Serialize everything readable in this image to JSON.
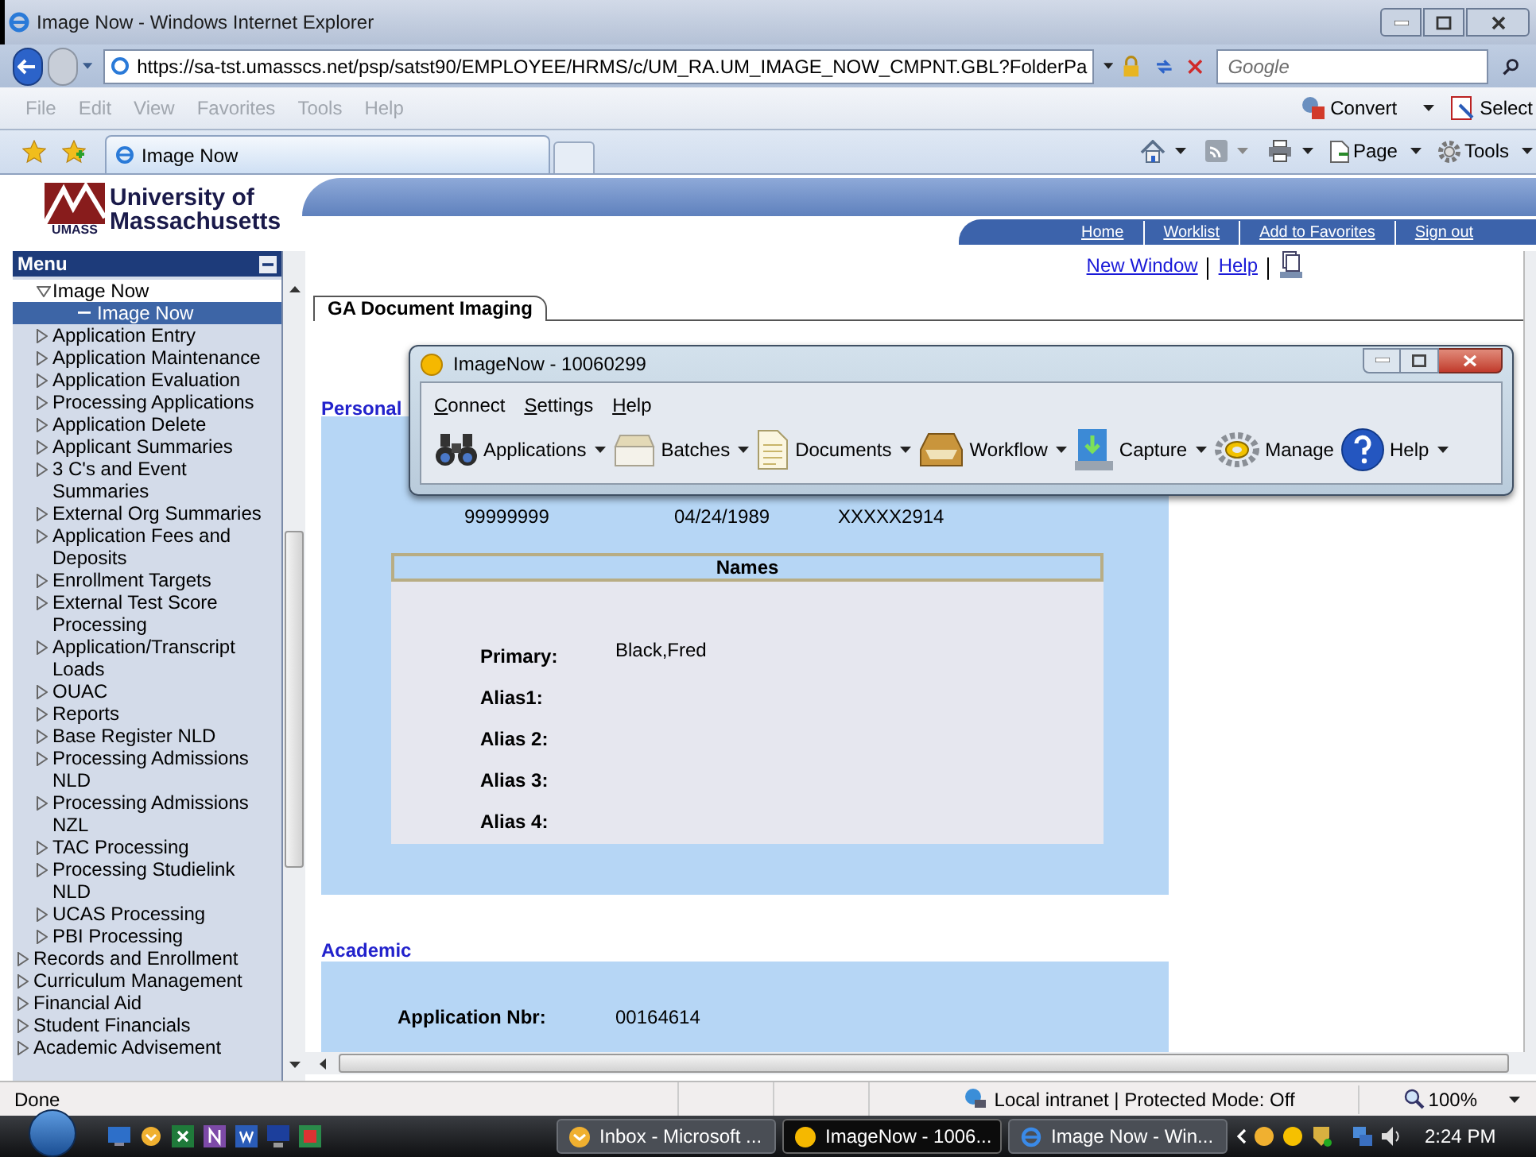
{
  "browser": {
    "title": "Image Now - Windows Internet Explorer",
    "address": "https://sa-tst.umasscs.net/psp/satst90/EMPLOYEE/HRMS/c/UM_RA.UM_IMAGE_NOW_CMPNT.GBL?FolderPa",
    "search_placeholder": "Google",
    "menu": [
      {
        "label": "File",
        "disabled": true
      },
      {
        "label": "Edit",
        "disabled": true
      },
      {
        "label": "View",
        "disabled": true
      },
      {
        "label": "Favorites",
        "disabled": true
      },
      {
        "label": "Tools",
        "disabled": true
      },
      {
        "label": "Help",
        "disabled": true
      }
    ],
    "commands": [
      {
        "label": "Convert",
        "dropdown": true
      },
      {
        "label": "Select",
        "dropdown": false
      }
    ],
    "tab": "Image Now",
    "toolbar": [
      {
        "label": "Page",
        "kind": "page"
      },
      {
        "label": "Tools",
        "kind": "tools"
      }
    ]
  },
  "header": {
    "logo_line1": "University of",
    "logo_line2": "Massachusetts",
    "logo_mark": "UMASS",
    "links": [
      "Home",
      "Worklist",
      "Add to Favorites",
      "Sign out"
    ]
  },
  "sidebar": {
    "title": "Menu",
    "tree": [
      {
        "children": [
          {
            "label": "Image Now",
            "expanded": true,
            "selected": false,
            "children": [
              {
                "label": "Image Now",
                "selected": true
              }
            ]
          },
          {
            "label": "Application Entry",
            "expanded": false,
            "selected": false
          },
          {
            "label": "Application Maintenance",
            "expanded": false,
            "selected": false
          },
          {
            "label": "Application Evaluation",
            "expanded": false,
            "selected": false
          },
          {
            "label": "Processing Applications",
            "expanded": false,
            "selected": false
          },
          {
            "label": "Application Delete",
            "expanded": false,
            "selected": false
          },
          {
            "label": "Applicant Summaries",
            "expanded": false,
            "selected": false
          },
          {
            "label": "3 C's and Event Summaries",
            "expanded": false,
            "selected": false
          },
          {
            "label": "External Org Summaries",
            "expanded": false,
            "selected": false
          },
          {
            "label": "Application Fees and Deposits",
            "expanded": false,
            "selected": false
          },
          {
            "label": "Enrollment Targets",
            "expanded": false,
            "selected": false
          },
          {
            "label": "External Test Score Processing",
            "expanded": false,
            "selected": false
          },
          {
            "label": "Application/Transcript Loads",
            "expanded": false,
            "selected": false
          },
          {
            "label": "OUAC",
            "expanded": false,
            "selected": false
          },
          {
            "label": "Reports",
            "expanded": false,
            "selected": false
          },
          {
            "label": "Base Register NLD",
            "expanded": false,
            "selected": false
          },
          {
            "label": "Processing Admissions NLD",
            "expanded": false,
            "selected": false
          },
          {
            "label": "Processing Admissions NZL",
            "expanded": false,
            "selected": false
          },
          {
            "label": "TAC Processing",
            "expanded": false,
            "selected": false
          },
          {
            "label": "Processing Studielink NLD",
            "expanded": false,
            "selected": false
          },
          {
            "label": "UCAS Processing",
            "expanded": false,
            "selected": false
          },
          {
            "label": "PBI Processing",
            "expanded": false,
            "selected": false
          }
        ]
      },
      {
        "label": "Records and Enrollment",
        "expanded": false,
        "selected": false
      },
      {
        "label": "Curriculum Management",
        "expanded": false,
        "selected": false
      },
      {
        "label": "Financial Aid",
        "expanded": false,
        "selected": false
      },
      {
        "label": "Student Financials",
        "expanded": false,
        "selected": false
      },
      {
        "label": "Academic Advisement",
        "expanded": false,
        "selected": false
      }
    ]
  },
  "page_links": [
    "New Window",
    "Help"
  ],
  "page_tab": "GA Document Imaging",
  "personal": {
    "title": "Personal",
    "values": [
      "99999999",
      "04/24/1989",
      "XXXXX2914"
    ]
  },
  "names": {
    "title": "Names",
    "fields": [
      {
        "label": "Primary:",
        "value": "Black,Fred"
      },
      {
        "label": "Alias1:"
      },
      {
        "label": "Alias 2:"
      },
      {
        "label": "Alias 3:"
      },
      {
        "label": "Alias 4:"
      }
    ]
  },
  "academic": {
    "title": "Academic",
    "fields": [
      {
        "label": "Application Nbr:",
        "value": "00164614"
      }
    ]
  },
  "imagenow": {
    "title": "ImageNow - 10060299",
    "menu": [
      "Connect",
      "Settings",
      "Help"
    ],
    "tools": [
      {
        "label": "Applications",
        "kind": "binoculars",
        "dropdown": true
      },
      {
        "label": "Batches",
        "kind": "batches",
        "dropdown": true
      },
      {
        "label": "Documents",
        "kind": "documents",
        "dropdown": true
      },
      {
        "label": "Workflow",
        "kind": "workflow",
        "dropdown": true
      },
      {
        "label": "Capture",
        "kind": "capture",
        "dropdown": true
      },
      {
        "label": "Manage",
        "kind": "manage",
        "dropdown": false
      },
      {
        "label": "Help",
        "kind": "help",
        "dropdown": true
      }
    ]
  },
  "status_bar": {
    "text": "Done",
    "zone": "Local intranet | Protected Mode: Off",
    "zoom": "100%"
  },
  "taskbar": {
    "tasks": [
      {
        "label": "Inbox - Microsoft ...",
        "kind": "mail",
        "selected": false
      },
      {
        "label": "ImageNow - 1006...",
        "kind": "imagenow",
        "selected": true
      },
      {
        "label": "Image Now - Win...",
        "kind": "browser",
        "selected": false
      }
    ],
    "clock": "2:24 PM"
  }
}
